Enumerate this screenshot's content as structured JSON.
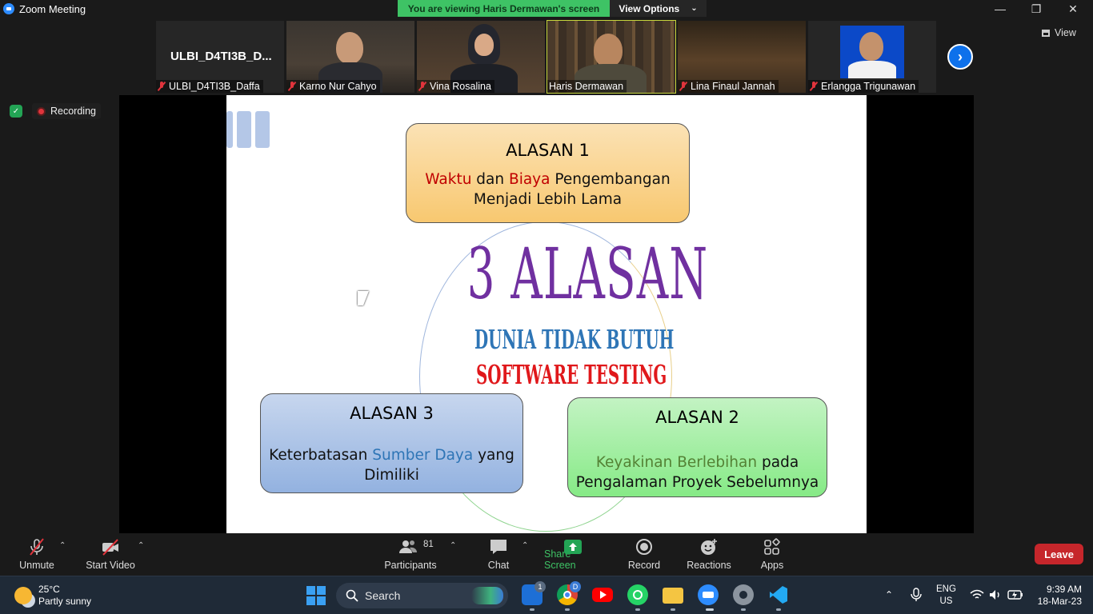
{
  "window": {
    "title": "Zoom Meeting"
  },
  "share_banner": {
    "message": "You are viewing Haris Dermawan's screen",
    "view_options": "View Options"
  },
  "gallery": {
    "view_label": "View",
    "tiles": [
      {
        "name": "ULBI_D4TI3B_Daffa",
        "big_label": "ULBI_D4TI3B_D...",
        "muted": true
      },
      {
        "name": "Karno Nur Cahyo",
        "muted": true
      },
      {
        "name": "Vina Rosalina",
        "muted": true
      },
      {
        "name": "Haris Dermawan",
        "muted": false
      },
      {
        "name": "Lina Finaul Jannah",
        "muted": true
      },
      {
        "name": "Erlangga Trigunawan",
        "muted": true
      }
    ]
  },
  "status": {
    "recording": "Recording"
  },
  "slide": {
    "title": "3 ALASAN",
    "subtitle_1": "DUNIA TIDAK BUTUH",
    "subtitle_2": "SOFTWARE TESTING",
    "box1": {
      "heading": "ALASAN 1",
      "w1": "Waktu",
      "w2": " dan ",
      "w3": "Biaya",
      "w4": " Pengembangan",
      "line2": "Menjadi Lebih Lama"
    },
    "box2": {
      "heading": "ALASAN 2",
      "w1": "Keyakinan Berlebihan",
      "w2": " pada",
      "line2": "Pengalaman Proyek Sebelumnya"
    },
    "box3": {
      "heading": "ALASAN 3",
      "w1": "Keterbatasan ",
      "w2": "Sumber Daya",
      "w3": " yang",
      "line2": "Dimiliki"
    }
  },
  "toolbar": {
    "unmute": "Unmute",
    "start_video": "Start Video",
    "participants": "Participants",
    "participants_count": "81",
    "chat": "Chat",
    "share_screen": "Share Screen",
    "record": "Record",
    "reactions": "Reactions",
    "apps": "Apps",
    "leave": "Leave"
  },
  "taskbar": {
    "temperature": "25°C",
    "weather": "Partly sunny",
    "search": "Search",
    "todo_badge": "1",
    "chrome_badge": "D",
    "lang_1": "ENG",
    "lang_2": "US",
    "time": "9:39 AM",
    "date": "18-Mar-23"
  },
  "colors": {
    "zoom_blue": "#0e71eb",
    "banner_green": "#3ec365",
    "leave_red": "#c6262b",
    "title_purple": "#7030a0"
  }
}
